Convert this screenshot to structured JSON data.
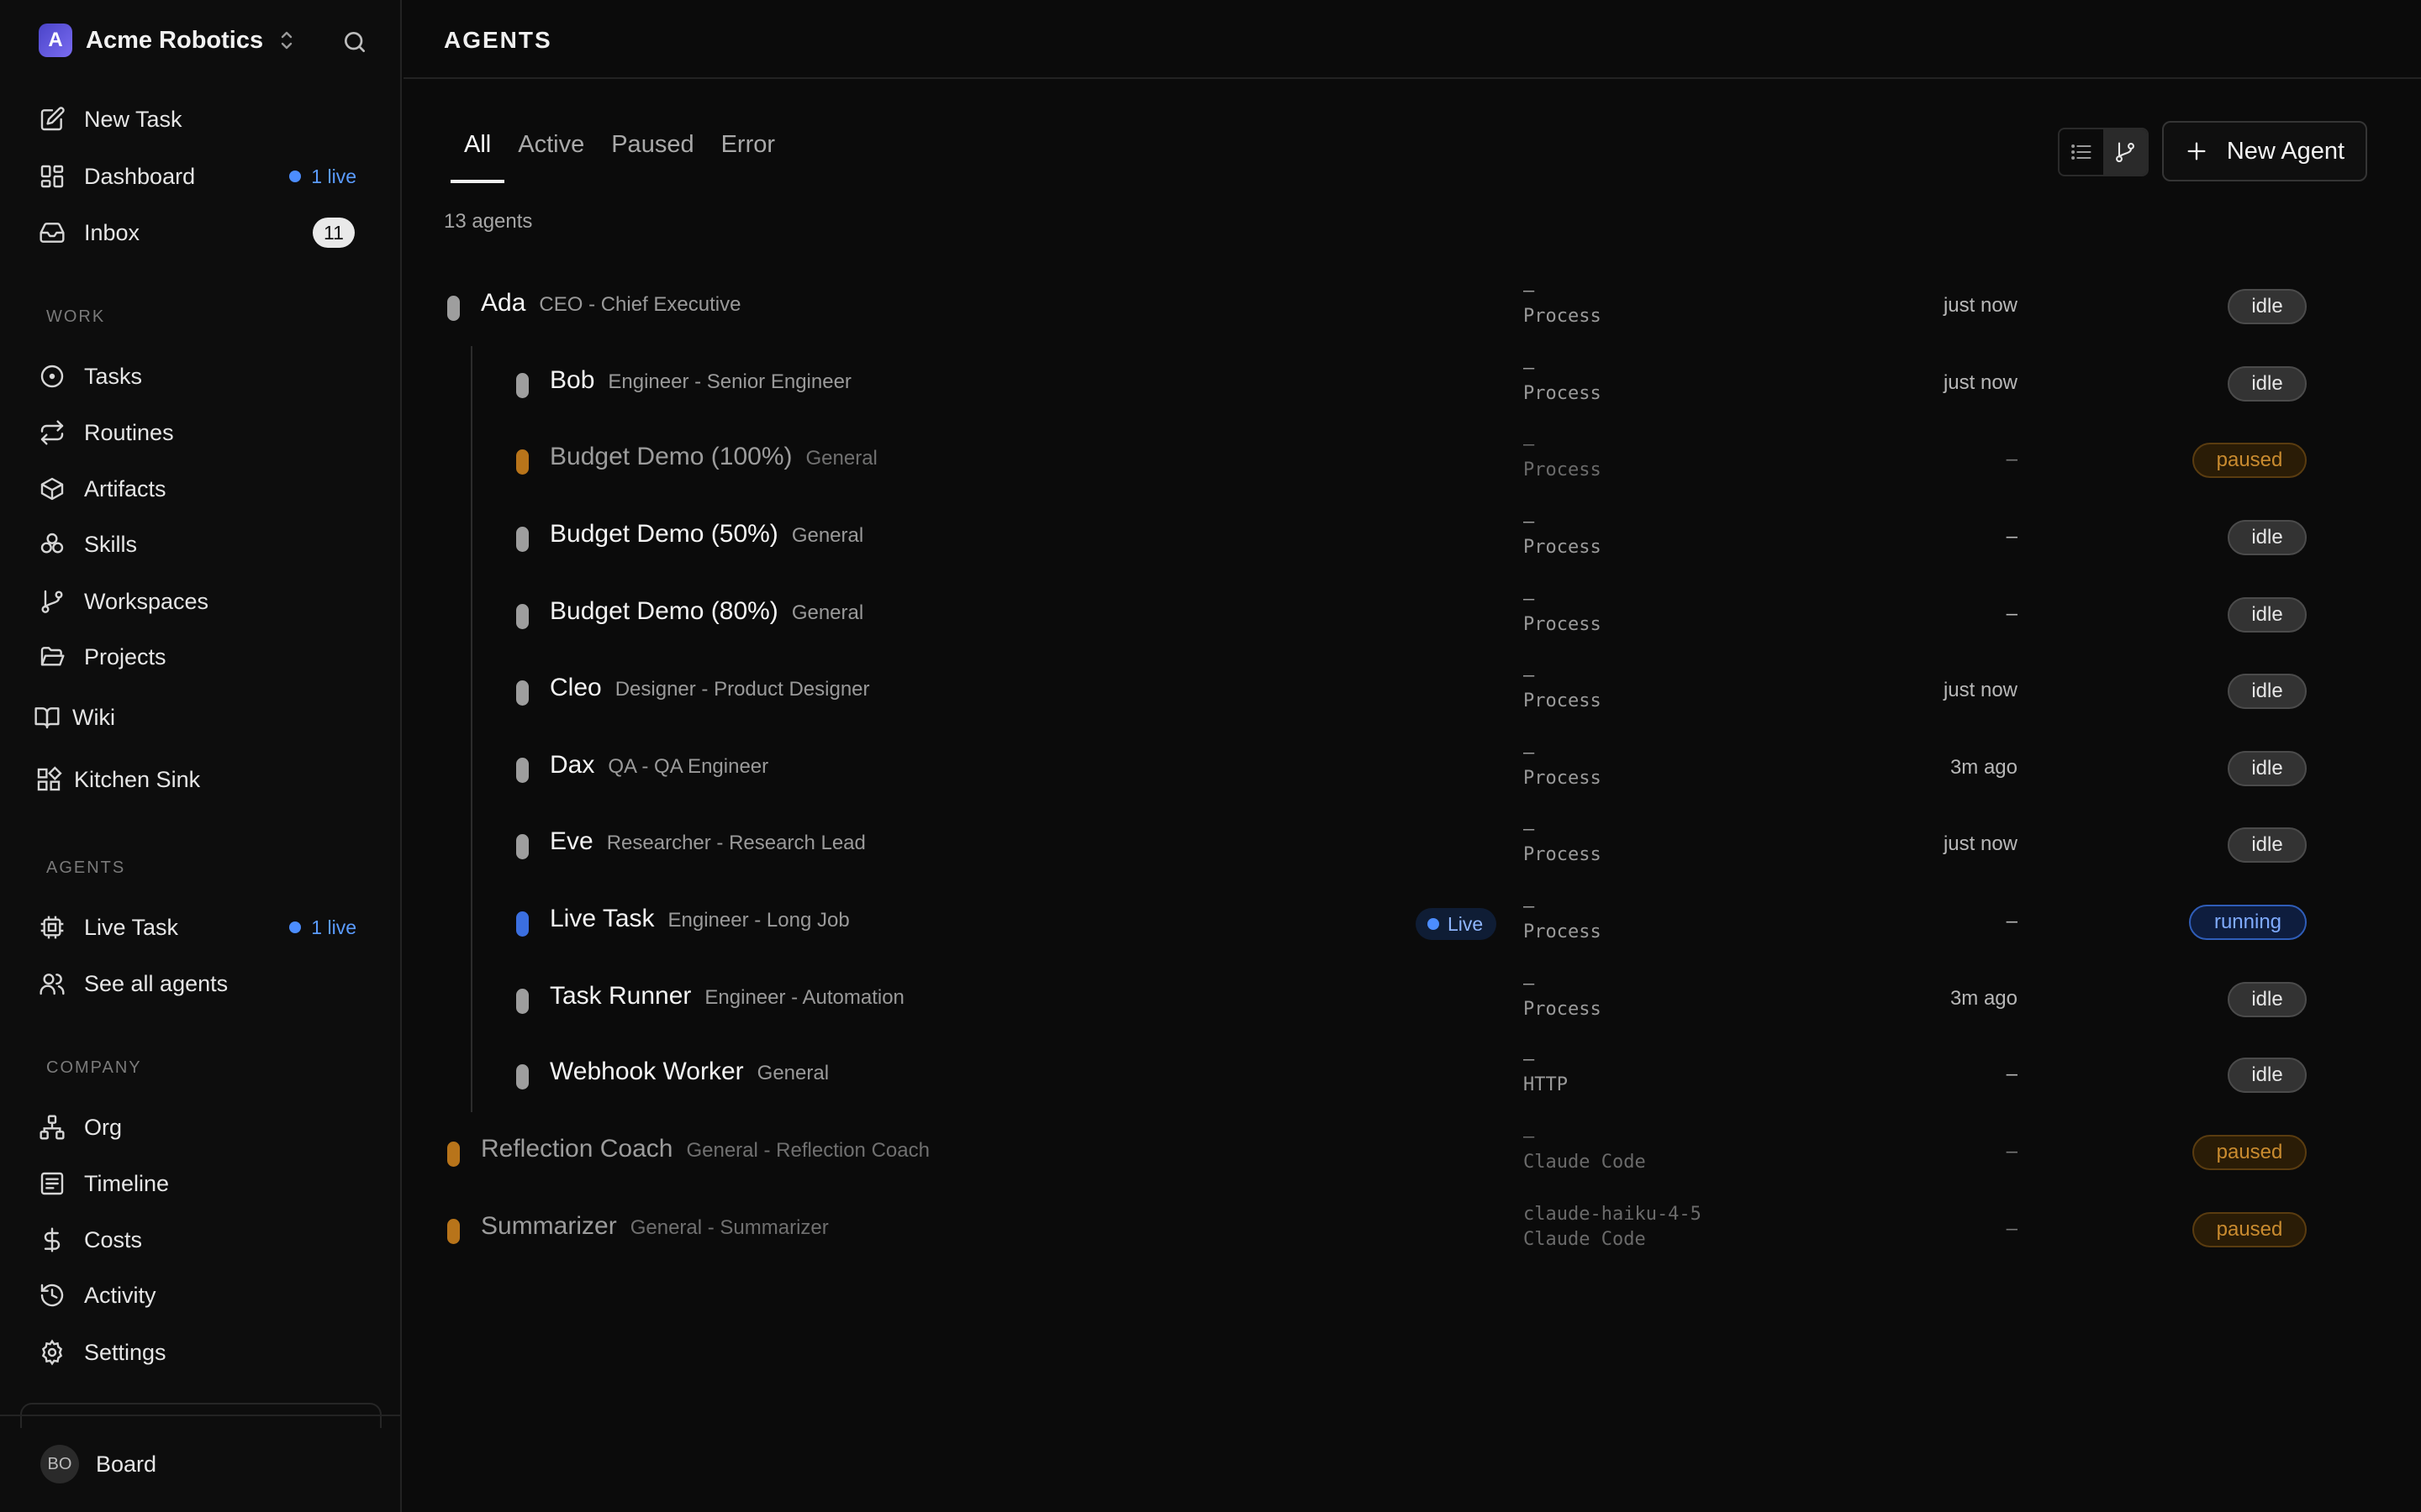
{
  "sidebar": {
    "company": {
      "initial": "A",
      "name": "Acme Robotics"
    },
    "top_items": [
      {
        "label": "New Task"
      },
      {
        "label": "Dashboard",
        "live": "1 live"
      },
      {
        "label": "Inbox",
        "count": "11"
      }
    ],
    "work_label": "WORK",
    "work_items": [
      {
        "label": "Tasks"
      },
      {
        "label": "Routines"
      },
      {
        "label": "Artifacts"
      },
      {
        "label": "Skills"
      },
      {
        "label": "Workspaces"
      },
      {
        "label": "Projects"
      },
      {
        "label": "Wiki"
      },
      {
        "label": "Kitchen Sink"
      }
    ],
    "agents_label": "AGENTS",
    "agents_items": [
      {
        "label": "Live Task",
        "live": "1 live"
      },
      {
        "label": "See all agents"
      }
    ],
    "company_label": "COMPANY",
    "company_items": [
      {
        "label": "Org"
      },
      {
        "label": "Timeline"
      },
      {
        "label": "Costs"
      },
      {
        "label": "Activity"
      },
      {
        "label": "Settings"
      }
    ],
    "user": {
      "initials": "BO",
      "name": "Board"
    }
  },
  "header": {
    "title": "AGENTS"
  },
  "tabs": [
    "All",
    "Active",
    "Paused",
    "Error"
  ],
  "active_tab": "All",
  "new_agent_label": "New Agent",
  "agent_count": "13 agents",
  "colors": {
    "idle": "#9e9e9e",
    "paused": "#b8741a",
    "running": "#3b6fe0",
    "accent": "#4c8dff"
  },
  "agents": [
    {
      "name": "Ada",
      "role": "CEO - Chief Executive",
      "model": "–",
      "adapter": "Process",
      "time": "just now",
      "status": "idle",
      "level": 0
    },
    {
      "name": "Bob",
      "role": "Engineer - Senior Engineer",
      "model": "–",
      "adapter": "Process",
      "time": "just now",
      "status": "idle",
      "level": 1
    },
    {
      "name": "Budget Demo (100%)",
      "role": "General",
      "model": "–",
      "adapter": "Process",
      "time": "–",
      "status": "paused",
      "level": 1
    },
    {
      "name": "Budget Demo (50%)",
      "role": "General",
      "model": "–",
      "adapter": "Process",
      "time": "–",
      "status": "idle",
      "level": 1
    },
    {
      "name": "Budget Demo (80%)",
      "role": "General",
      "model": "–",
      "adapter": "Process",
      "time": "–",
      "status": "idle",
      "level": 1
    },
    {
      "name": "Cleo",
      "role": "Designer - Product Designer",
      "model": "–",
      "adapter": "Process",
      "time": "just now",
      "status": "idle",
      "level": 1
    },
    {
      "name": "Dax",
      "role": "QA - QA Engineer",
      "model": "–",
      "adapter": "Process",
      "time": "3m ago",
      "status": "idle",
      "level": 1
    },
    {
      "name": "Eve",
      "role": "Researcher - Research Lead",
      "model": "–",
      "adapter": "Process",
      "time": "just now",
      "status": "idle",
      "level": 1
    },
    {
      "name": "Live Task",
      "role": "Engineer - Long Job",
      "live": "Live",
      "model": "–",
      "adapter": "Process",
      "time": "–",
      "status": "running",
      "level": 1
    },
    {
      "name": "Task Runner",
      "role": "Engineer - Automation",
      "model": "–",
      "adapter": "Process",
      "time": "3m ago",
      "status": "idle",
      "level": 1
    },
    {
      "name": "Webhook Worker",
      "role": "General",
      "model": "–",
      "adapter": "HTTP",
      "time": "–",
      "status": "idle",
      "level": 1
    },
    {
      "name": "Reflection Coach",
      "role": "General - Reflection Coach",
      "model": "–",
      "adapter": "Claude Code",
      "time": "–",
      "status": "paused",
      "level": 0
    },
    {
      "name": "Summarizer",
      "role": "General - Summarizer",
      "model": "claude-haiku-4-5",
      "adapter": "Claude Code",
      "time": "–",
      "status": "paused",
      "level": 0
    }
  ]
}
